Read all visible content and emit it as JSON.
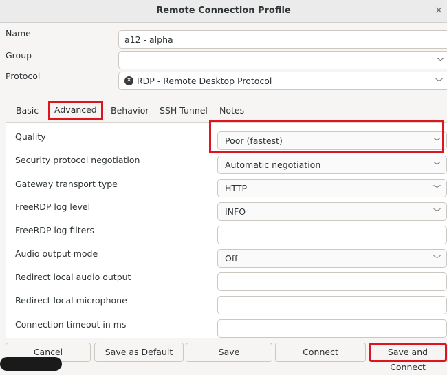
{
  "window": {
    "title": "Remote Connection Profile",
    "close_glyph": "×"
  },
  "form": {
    "name_label": "Name",
    "name_value": "a12 - alpha",
    "group_label": "Group",
    "group_value": "",
    "protocol_label": "Protocol",
    "protocol_value": "RDP - Remote Desktop Protocol"
  },
  "tabs": [
    {
      "label": "Basic"
    },
    {
      "label": "Advanced",
      "active": true
    },
    {
      "label": "Behavior"
    },
    {
      "label": "SSH Tunnel"
    },
    {
      "label": "Notes"
    }
  ],
  "advanced": {
    "rows": [
      {
        "label": "Quality",
        "value": "Poor (fastest)",
        "dropdown": true
      },
      {
        "label": "Security protocol negotiation",
        "value": "Automatic negotiation",
        "dropdown": true
      },
      {
        "label": "Gateway transport type",
        "value": "HTTP",
        "dropdown": true
      },
      {
        "label": "FreeRDP log level",
        "value": "INFO",
        "dropdown": true
      },
      {
        "label": "FreeRDP log filters",
        "value": "",
        "dropdown": false
      },
      {
        "label": "Audio output mode",
        "value": "Off",
        "dropdown": true
      },
      {
        "label": "Redirect local audio output",
        "value": "",
        "dropdown": false
      },
      {
        "label": "Redirect local microphone",
        "value": "",
        "dropdown": false
      },
      {
        "label": "Connection timeout in ms",
        "value": "",
        "dropdown": false
      }
    ]
  },
  "buttons": {
    "cancel": "Cancel",
    "save_default": "Save as Default",
    "save": "Save",
    "connect": "Connect",
    "save_connect": "Save and Connect"
  },
  "colors": {
    "highlight": "#e0141e"
  },
  "icons": {
    "chevron": "chevron-down-icon",
    "protocol": "rdp-protocol-icon"
  }
}
